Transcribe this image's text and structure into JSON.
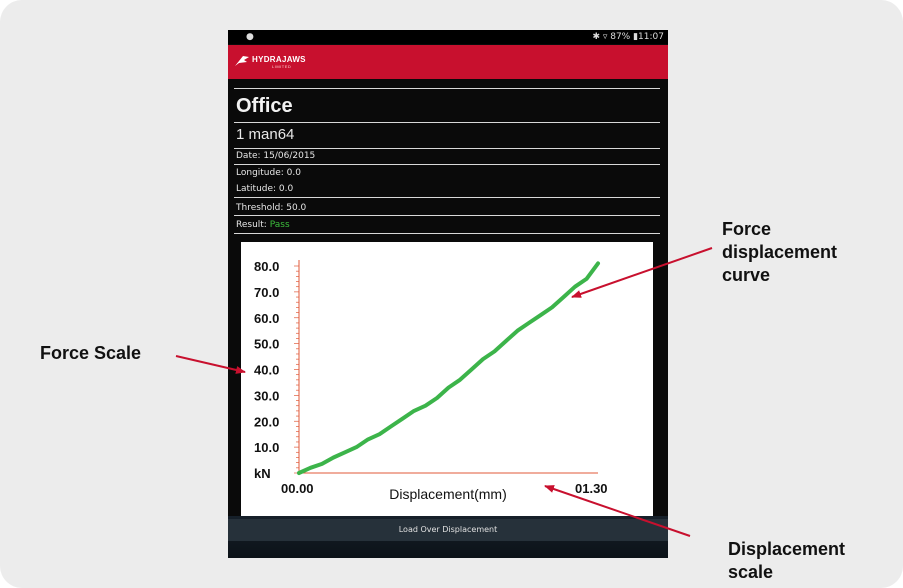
{
  "status_bar": {
    "signal": "●",
    "right": "✱ ▿ 87% ▮11:07"
  },
  "brand": {
    "name": "HYDRAJAWS",
    "sub": "LIMITED"
  },
  "record": {
    "site": "Office",
    "name": "1 man64",
    "date_label": "Date: 15/06/2015",
    "longitude_label": "Longitude: 0.0",
    "latitude_label": "Latitude:   0.0",
    "threshold_label": "Threshold: 50.0",
    "result_prefix": "Result:",
    "result_value": "Pass",
    "result_color": "#3cbf3c"
  },
  "footer": {
    "button_label": "Load Over Displacement"
  },
  "callouts": {
    "force_scale": "Force Scale",
    "curve": [
      "Force",
      "displacement",
      "curve"
    ],
    "displacement_scale": [
      "Displacement",
      "scale"
    ]
  },
  "chart_data": {
    "type": "line",
    "title": "",
    "xlabel": "Displacement(mm)",
    "ylabel": "kN",
    "x_tick_labels": [
      "00.00",
      "01.30"
    ],
    "y_tick_labels": [
      "80.0",
      "70.0",
      "60.0",
      "50.0",
      "40.0",
      "30.0",
      "20.0",
      "10.0",
      "kN"
    ],
    "xlim": [
      0,
      1.3
    ],
    "ylim": [
      0,
      80
    ],
    "line_color": "#3cb44a",
    "axis_color": "#e05a3a",
    "series": [
      {
        "x": [
          0,
          0.05,
          0.1,
          0.15,
          0.2,
          0.25,
          0.3,
          0.35,
          0.4,
          0.45,
          0.5,
          0.55,
          0.6,
          0.65,
          0.7,
          0.75,
          0.8,
          0.85,
          0.9,
          0.95,
          1.0,
          1.05,
          1.1,
          1.15,
          1.2,
          1.25,
          1.3
        ],
        "y": [
          0,
          2,
          3.5,
          6,
          8,
          10,
          13,
          15,
          18,
          21,
          24,
          26,
          29,
          33,
          36,
          40,
          44,
          47,
          51,
          55,
          58,
          61,
          64,
          68,
          72,
          75,
          81
        ]
      }
    ]
  }
}
